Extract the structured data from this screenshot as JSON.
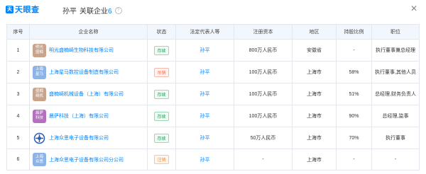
{
  "header": {
    "logo_mark": "天",
    "logo_text": "天眼查",
    "person": "孙平",
    "label": "关联企业",
    "count": "6",
    "help_icon": "question-icon",
    "close_icon": "close-icon"
  },
  "table": {
    "columns": [
      "序号",
      "企业名称",
      "状态",
      "法定代表人等",
      "注册资本",
      "地区",
      "持股比例",
      "职位"
    ],
    "rows": [
      {
        "index": "1",
        "logo_text": "明光\n盛楠",
        "logo_color": "#c9a48c",
        "company": "明光盛楠崎生物科技有限公司",
        "status": "存续",
        "status_type": "green",
        "person": "孙平",
        "capital": "800万人民币",
        "region": "安徽省",
        "share": "-",
        "position": "执行董事兼总经理"
      },
      {
        "index": "2",
        "logo_text": "上海\n星马",
        "logo_color": "#8db4e8",
        "company": "上海星马数控设备制造有限公司",
        "status": "吊销",
        "status_type": "red",
        "person": "孙平",
        "capital": "100万人民币",
        "region": "上海市",
        "share": "58%",
        "position": "执行董事,其他人员"
      },
      {
        "index": "3",
        "logo_text": "盛楠\n崎机",
        "logo_color": "#c9a48c",
        "company": "盛楠崎机械设备（上海）有限公司",
        "status": "存续",
        "status_type": "green",
        "person": "孙平",
        "capital": "100万人民币",
        "region": "上海市",
        "share": "51%",
        "position": "总经理,财务负责人"
      },
      {
        "index": "4",
        "logo_text": "晨萨\n科技",
        "logo_color": "#b46fbf",
        "company": "晨萨科技（上海）有限公司",
        "status": "存续",
        "status_type": "green",
        "person": "孙平",
        "capital": "100万人民币",
        "region": "上海市",
        "share": "90%",
        "position": "总经理,监事"
      },
      {
        "index": "5",
        "logo_text": "",
        "logo_color": "#ffffff",
        "company": "上海众思电子设备有限公司",
        "status": "存续",
        "status_type": "green",
        "person": "孙平",
        "capital": "50万人民币",
        "region": "上海市",
        "share": "70%",
        "position": "执行董事"
      },
      {
        "index": "6",
        "logo_text": "上海\n众思",
        "logo_color": "#8db4e8",
        "company": "上海众思电子设备有限公司分公司",
        "status": "注销",
        "status_type": "orange",
        "person": "孙平",
        "capital": "-",
        "region": "上海市",
        "share": "-",
        "position": "-"
      }
    ]
  }
}
